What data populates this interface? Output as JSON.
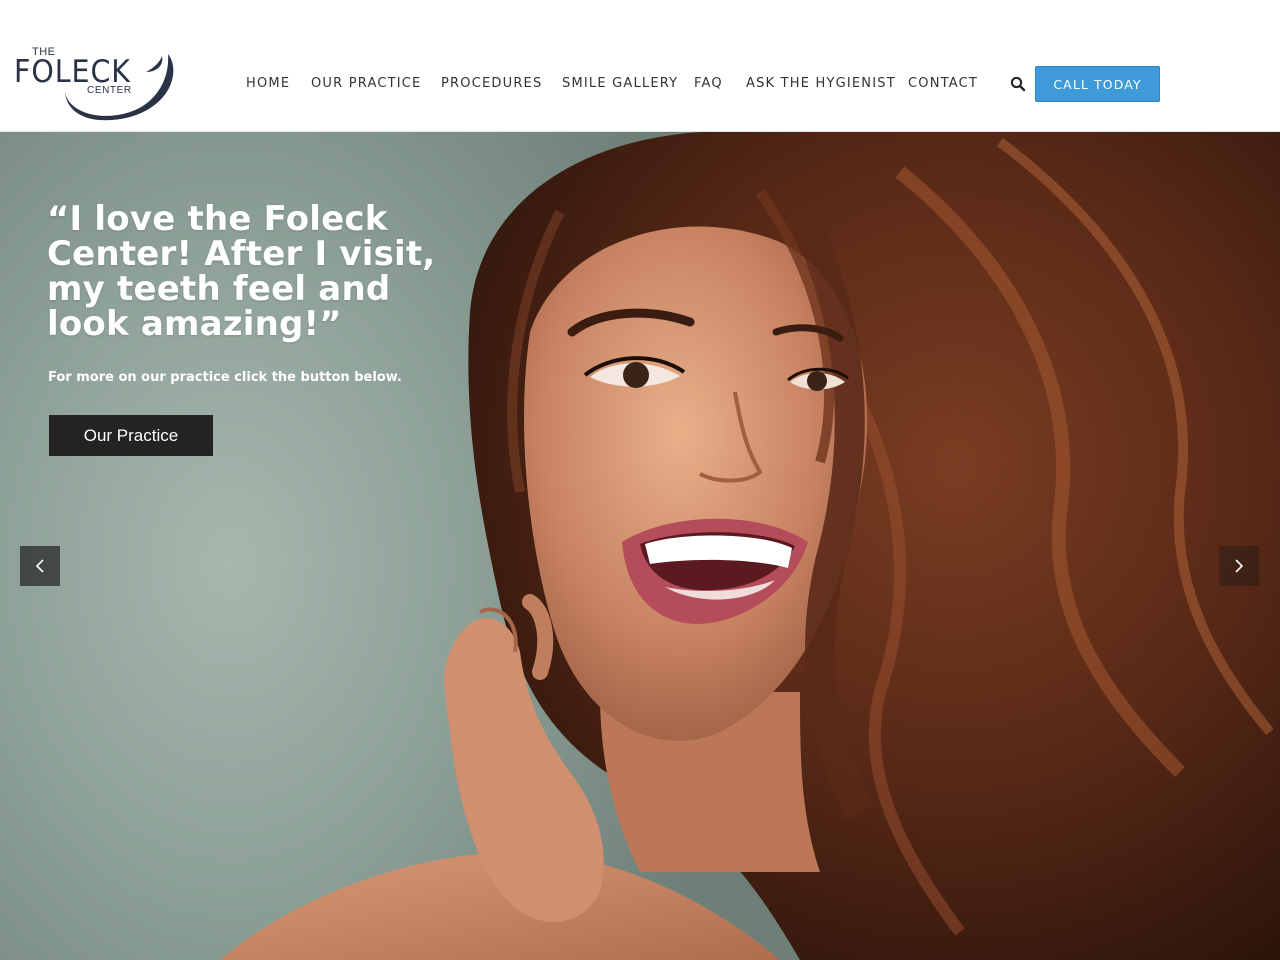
{
  "logo": {
    "the": "THE",
    "main": "FOLECK",
    "center": "CENTER"
  },
  "nav": {
    "items": [
      {
        "label": "HOME",
        "icon": null
      },
      {
        "label": "OUR PRACTICE",
        "icon": null
      },
      {
        "label": "PROCEDURES",
        "icon": null
      },
      {
        "label": "SMILE GALLERY",
        "icon": null
      },
      {
        "label": "FAQ",
        "icon": null
      },
      {
        "label": "ASK THE HYGIENIST",
        "icon": null
      },
      {
        "label": "CONTACT",
        "icon": null
      }
    ],
    "search_icon": "search-icon",
    "cta_label": "CALL TODAY"
  },
  "hero": {
    "quote": "“I love the Foleck Center! After I visit, my teeth feel and look amazing!”",
    "subtext": "For more on our practice click the button below.",
    "button_label": "Our Practice",
    "prev_icon": "chevron-left-icon",
    "next_icon": "chevron-right-icon"
  },
  "colors": {
    "brand_navy": "#2a3346",
    "cta_blue": "#3f9ad9",
    "button_dark": "#232323",
    "nav_text": "#333333"
  }
}
